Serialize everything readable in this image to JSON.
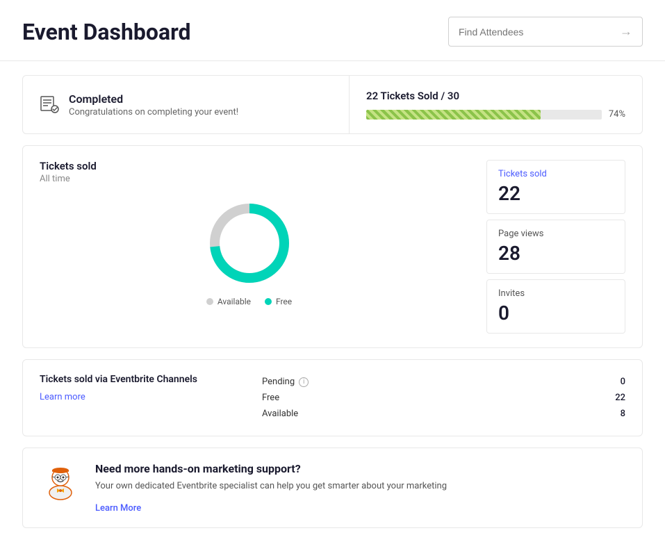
{
  "header": {
    "title": "Event Dashboard",
    "search": {
      "placeholder": "Find Attendees"
    }
  },
  "status_card": {
    "icon_name": "completed-icon",
    "status": "Completed",
    "message": "Congratulations on completing your event!",
    "tickets_sold_label": "22 Tickets Sold / 30",
    "progress_percent": 74,
    "progress_label": "74%"
  },
  "tickets_chart": {
    "title": "Tickets sold",
    "subtitle": "All time",
    "legend": {
      "available_label": "Available",
      "free_label": "Free"
    },
    "donut": {
      "total": 30,
      "free": 22,
      "available": 8
    }
  },
  "stats": [
    {
      "label": "Tickets sold",
      "value": "22",
      "type": "primary"
    },
    {
      "label": "Page views",
      "value": "28",
      "type": "secondary"
    },
    {
      "label": "Invites",
      "value": "0",
      "type": "secondary"
    }
  ],
  "channels": {
    "title": "Tickets sold via Eventbrite Channels",
    "learn_more_label": "Learn more",
    "rows": [
      {
        "label": "Pending",
        "value": "0",
        "has_info": true
      },
      {
        "label": "Free",
        "value": "22",
        "has_info": false
      },
      {
        "label": "Available",
        "value": "8",
        "has_info": false
      }
    ]
  },
  "marketing": {
    "title": "Need more hands-on marketing support?",
    "description": "Your own dedicated Eventbrite specialist can help you get smarter about your marketing",
    "learn_more_label": "Learn More"
  }
}
